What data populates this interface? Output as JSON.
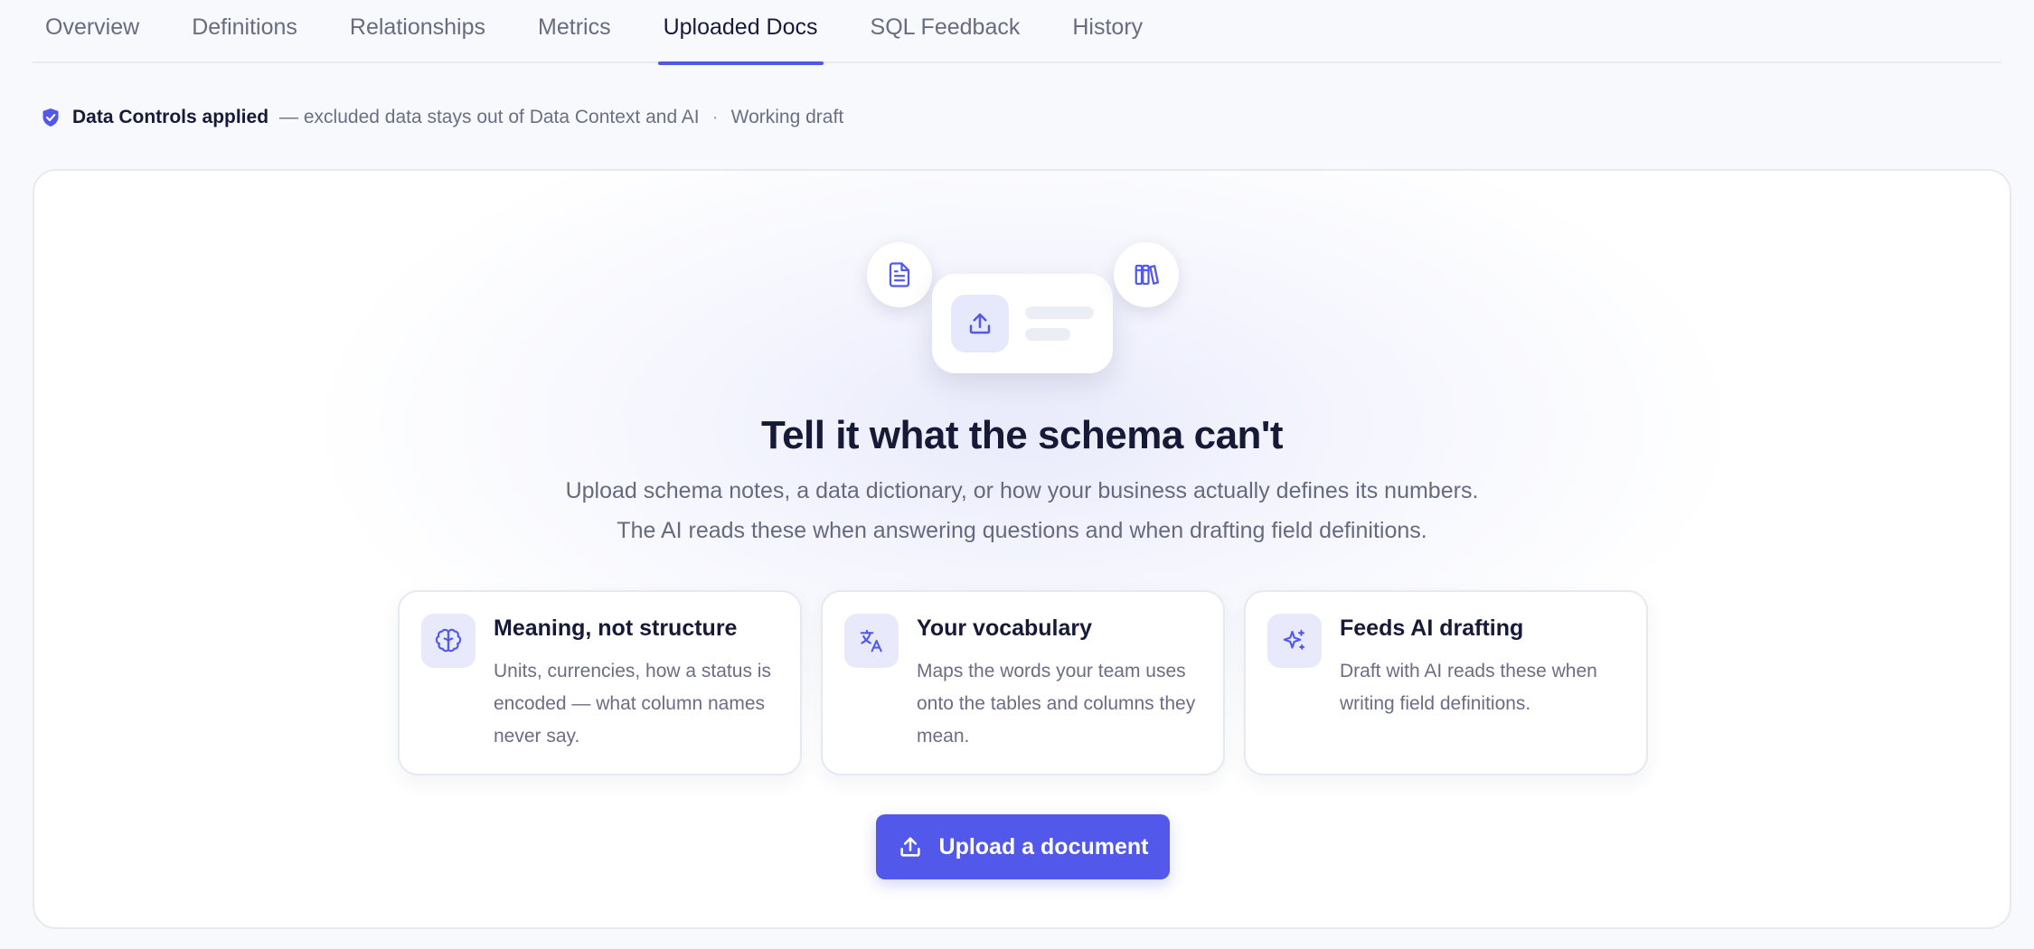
{
  "tabs": [
    {
      "label": "Overview"
    },
    {
      "label": "Definitions"
    },
    {
      "label": "Relationships"
    },
    {
      "label": "Metrics"
    },
    {
      "label": "Uploaded Docs",
      "active": true
    },
    {
      "label": "SQL Feedback"
    },
    {
      "label": "History"
    }
  ],
  "controls": {
    "icon": "shield-check-icon",
    "title": "Data Controls applied",
    "description": "— excluded data stays out of Data Context and AI",
    "separator": "·",
    "status": "Working draft"
  },
  "empty_state": {
    "heading": "Tell it what the schema can't",
    "subtitle_line1": "Upload schema notes, a data dictionary, or how your business actually defines its numbers.",
    "subtitle_line2": "The AI reads these when answering questions and when drafting field definitions.",
    "illustration_icons": [
      "document-icon",
      "upload-icon",
      "books-icon"
    ]
  },
  "features": [
    {
      "icon": "brain-icon",
      "title": "Meaning, not structure",
      "description": "Units, currencies, how a status is encoded — what column names never say."
    },
    {
      "icon": "translate-icon",
      "title": "Your vocabulary",
      "description": "Maps the words your team uses onto the tables and columns they mean."
    },
    {
      "icon": "sparkle-icon",
      "title": "Feeds AI drafting",
      "description": "Draft with AI reads these when writing field definitions."
    }
  ],
  "upload_button": {
    "label": "Upload a document",
    "icon": "upload-icon"
  },
  "colors": {
    "accent": "#5259ea",
    "background": "#f8f9fc",
    "icon_tile": "#e8eafb"
  }
}
